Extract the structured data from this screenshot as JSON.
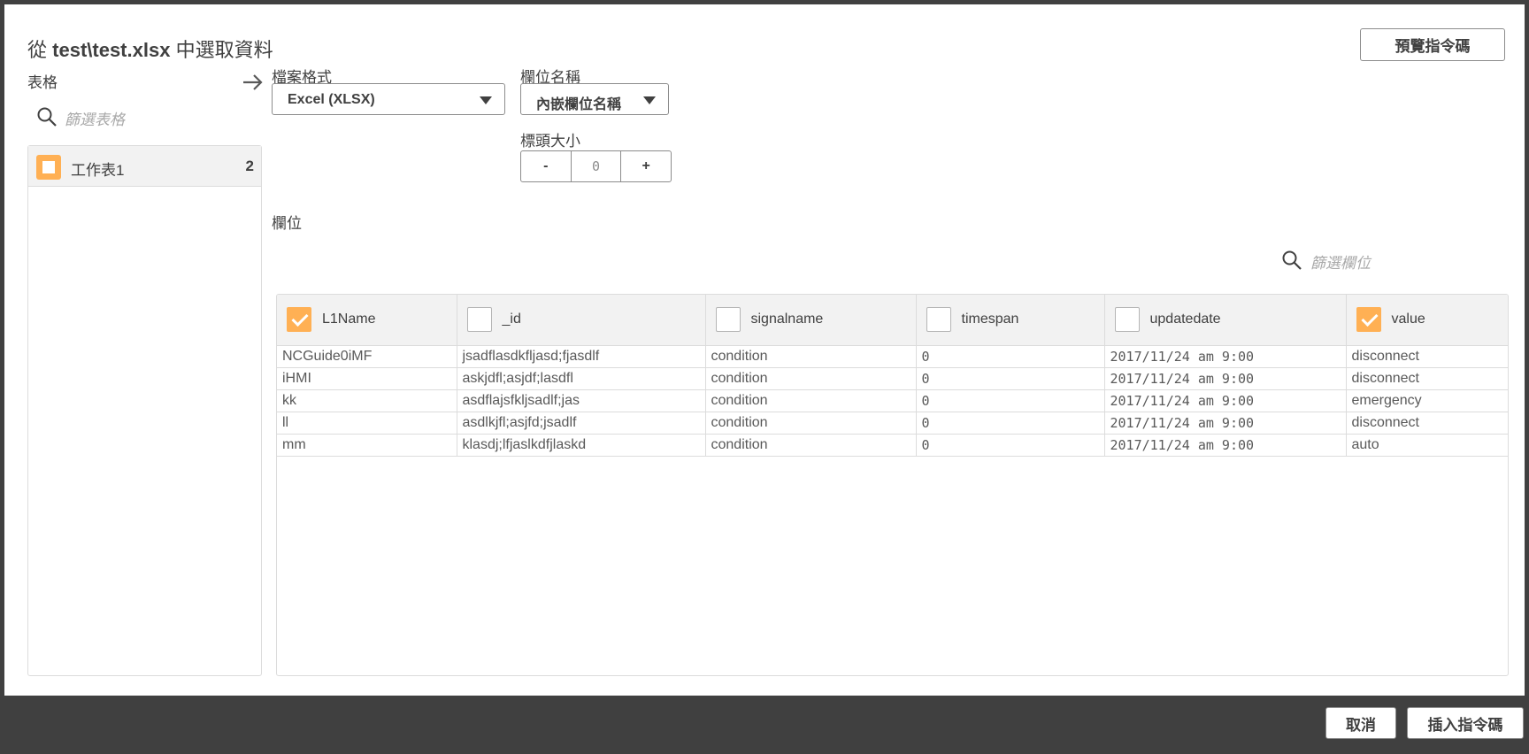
{
  "dialog": {
    "title_prefix": "從",
    "title_file": "test\\test.xlsx",
    "title_suffix": "中選取資料",
    "preview_button": "預覽指令碼"
  },
  "tables_section": {
    "label": "表格",
    "search_placeholder": "篩選表格",
    "items": [
      {
        "name": "工作表1",
        "count": "2",
        "selected": true
      }
    ]
  },
  "format": {
    "file_format_label": "檔案格式",
    "file_format_value": "Excel (XLSX)",
    "field_names_label": "欄位名稱",
    "field_names_value": "內嵌欄位名稱",
    "header_size_label": "標頭大小",
    "header_size_minus": "-",
    "header_size_value": "0",
    "header_size_plus": "+"
  },
  "fields_section": {
    "label": "欄位",
    "search_placeholder": "篩選欄位",
    "columns": [
      {
        "name": "L1Name",
        "checked": true
      },
      {
        "name": "_id",
        "checked": false
      },
      {
        "name": "signalname",
        "checked": false
      },
      {
        "name": "timespan",
        "checked": false
      },
      {
        "name": "updatedate",
        "checked": false
      },
      {
        "name": "value",
        "checked": true
      }
    ],
    "rows": [
      [
        "NCGuide0iMF",
        "jsadflasdkfljasd;fjasdlf",
        "condition",
        "0",
        "2017/11/24 am 9:00",
        "disconnect"
      ],
      [
        "iHMI",
        "askjdfl;asjdf;lasdfl",
        "condition",
        "0",
        "2017/11/24 am 9:00",
        "disconnect"
      ],
      [
        "kk",
        "asdflajsfkljsadlf;jas",
        "condition",
        "0",
        "2017/11/24 am 9:00",
        "emergency"
      ],
      [
        "ll",
        "asdlkjfl;asjfd;jsadlf",
        "condition",
        "0",
        "2017/11/24 am 9:00",
        "disconnect"
      ],
      [
        "mm",
        "klasdj;lfjaslkdfjlaskd",
        "condition",
        "0",
        "2017/11/24 am 9:00",
        "auto"
      ]
    ]
  },
  "footer": {
    "cancel_button": "取消",
    "insert_button": "插入指令碼"
  },
  "colors": {
    "accent": "#ffb054",
    "footer_bg": "#404040"
  }
}
